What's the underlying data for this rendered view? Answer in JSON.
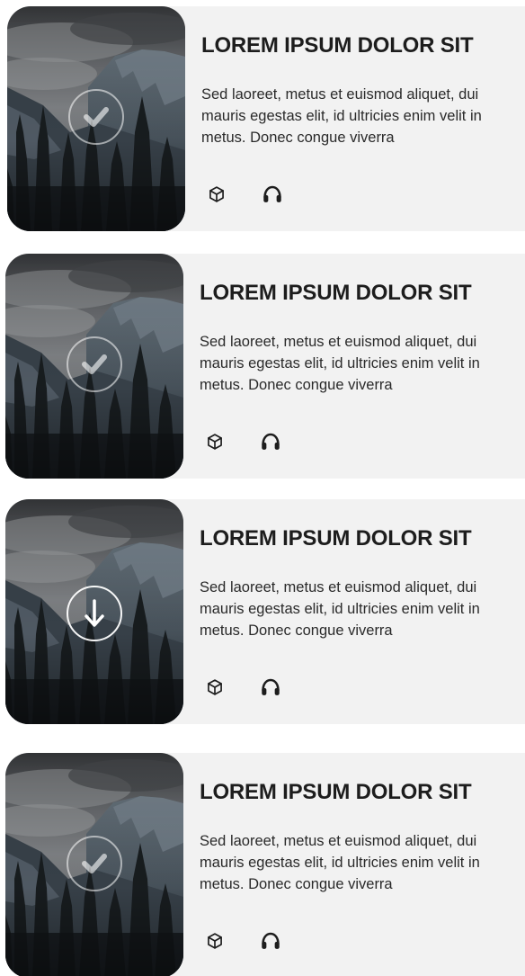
{
  "cards": [
    {
      "title": "LOREM IPSUM DOLOR SIT",
      "description": "Sed laoreet, metus et euismod aliquet, dui mauris egestas elit, id ultricies enim velit in metus. Donec congue viverra",
      "status": "downloaded",
      "status_icon": "check-icon",
      "icons": [
        "cube-icon",
        "headphones-icon"
      ]
    },
    {
      "title": "LOREM IPSUM DOLOR SIT",
      "description": "Sed laoreet, metus et euismod aliquet, dui mauris egestas elit, id ultricies enim velit in metus. Donec congue viverra",
      "status": "downloaded",
      "status_icon": "check-icon",
      "icons": [
        "cube-icon",
        "headphones-icon"
      ]
    },
    {
      "title": "LOREM IPSUM DOLOR SIT",
      "description": "Sed laoreet, metus et euismod aliquet, dui mauris egestas elit, id ultricies enim velit in metus. Donec congue viverra",
      "status": "download",
      "status_icon": "arrow-down-icon",
      "icons": [
        "cube-icon",
        "headphones-icon"
      ]
    },
    {
      "title": "LOREM IPSUM DOLOR SIT",
      "description": "Sed laoreet, metus et euismod aliquet, dui mauris egestas elit, id ultricies enim velit in metus. Donec congue viverra",
      "status": "downloaded",
      "status_icon": "check-icon",
      "icons": [
        "cube-icon",
        "headphones-icon"
      ]
    }
  ],
  "colors": {
    "card_background": "#f2f2f2",
    "title": "#1d1d1d",
    "text": "#2a2a2a"
  }
}
